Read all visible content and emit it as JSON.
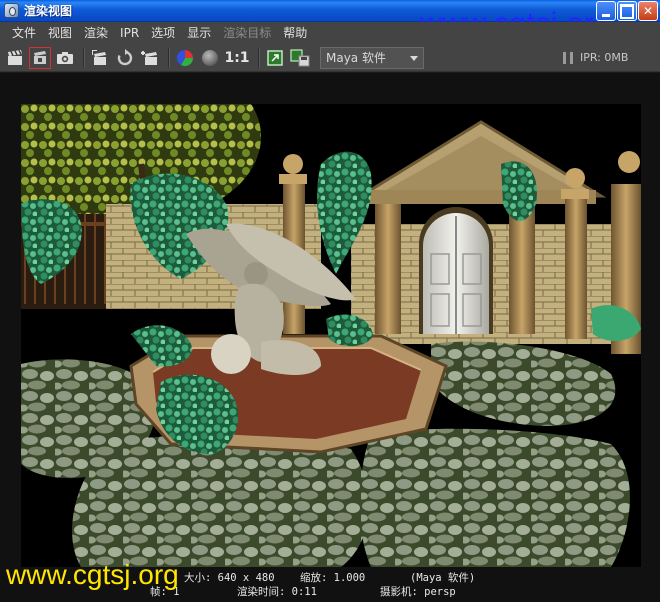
{
  "window": {
    "title": "渲染视图",
    "watermark_top": "www.cgtsj.org"
  },
  "menu": {
    "items": [
      {
        "label": "文件",
        "enabled": true
      },
      {
        "label": "视图",
        "enabled": true
      },
      {
        "label": "渲染",
        "enabled": true
      },
      {
        "label": "IPR",
        "enabled": true
      },
      {
        "label": "选项",
        "enabled": true
      },
      {
        "label": "显示",
        "enabled": true
      },
      {
        "label": "渲染目标",
        "enabled": false
      },
      {
        "label": "帮助",
        "enabled": true
      }
    ]
  },
  "toolbar": {
    "ratio_label": "1:1",
    "renderer_selected": "Maya 软件",
    "ipr_status": "IPR: 0MB",
    "icons": [
      "render-clapper-icon",
      "ipr-render-icon",
      "snapshot-camera-icon",
      "render-region-icon",
      "refresh-icon",
      "keep-image-icon",
      "color-channels-icon",
      "alpha-channel-icon",
      "real-size-icon",
      "frame-image-icon",
      "save-image-icon"
    ]
  },
  "render_info": {
    "size": "大小: 640 x 480",
    "zoom": "缩放: 1.000",
    "renderer": "(Maya 软件)",
    "frame": "帧: 1",
    "render_time": "渲染时间: 0:11",
    "camera": "摄影机: persp"
  },
  "watermark_bottom": "www.cgtsj.org",
  "colors": {
    "titlebar": "#0b4fcd",
    "panel": "#444444",
    "watermark_top": "#2323ff",
    "watermark_bottom": "#ffe600"
  }
}
